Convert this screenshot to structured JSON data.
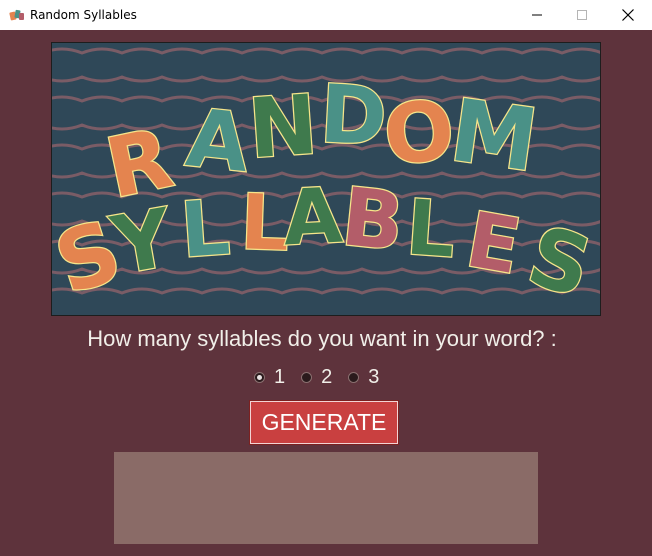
{
  "window": {
    "title": "Random Syllables",
    "controls": [
      "minimize-icon",
      "maximize-icon",
      "close-icon"
    ]
  },
  "banner": {
    "word_top": "RANDOM",
    "word_bottom": "SYLLABLES",
    "colors": {
      "background": "#2f4858",
      "waves": "#7a5c66",
      "outline": "#f6e58a",
      "orange": "#e4844f",
      "teal": "#4a9187",
      "green": "#3f7a4d",
      "rose": "#b35d69"
    }
  },
  "question": "How many syllables do you want in your word? :",
  "syllable_options": [
    {
      "label": "1",
      "selected": true
    },
    {
      "label": "2",
      "selected": false
    },
    {
      "label": "3",
      "selected": false
    }
  ],
  "generate_button": {
    "label": "GENERATE",
    "color": "#c94040"
  },
  "output": {
    "text": "",
    "background": "#8a6b67"
  }
}
